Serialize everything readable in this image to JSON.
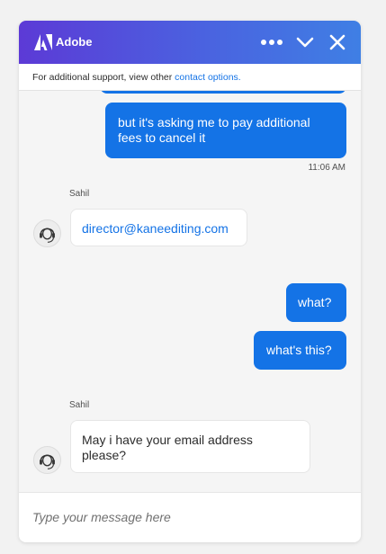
{
  "header": {
    "brand": "Adobe",
    "logo_icon": "adobe-logo-icon",
    "more_icon": "more-dots-icon",
    "collapse_icon": "chevron-down-icon",
    "close_icon": "close-icon",
    "gradient_colors": [
      "#5c3ad6",
      "#3f7fe4"
    ]
  },
  "support": {
    "text": "For additional support, view other ",
    "link": "contact options."
  },
  "messages": [
    {
      "from": "user",
      "text": "but it's asking me to pay additional fees to cancel it",
      "time": "11:06 AM"
    },
    {
      "from": "agent",
      "sender": "Sahil",
      "text": "director@kaneediting.com",
      "avatar_icon": "headset-agent-icon"
    },
    {
      "from": "user",
      "text": "what?"
    },
    {
      "from": "user",
      "text": "what's this?"
    },
    {
      "from": "agent",
      "sender": "Sahil",
      "text": "May i have your email address please?",
      "avatar_icon": "headset-agent-icon"
    }
  ],
  "composer": {
    "placeholder": "Type your message here"
  },
  "colors": {
    "user_bubble": "#1473e6",
    "link": "#1473e6"
  }
}
